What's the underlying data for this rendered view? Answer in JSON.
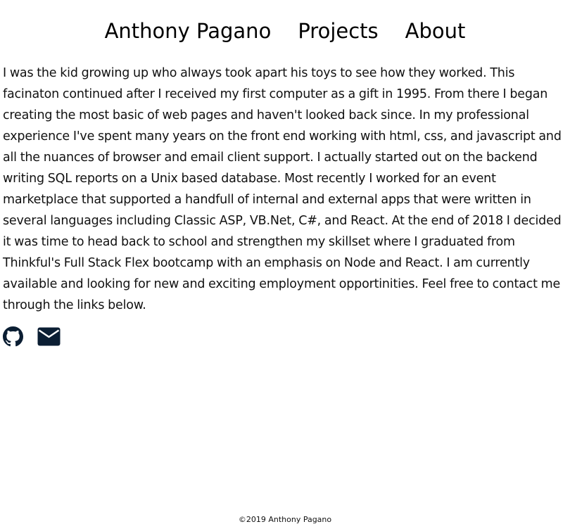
{
  "nav": {
    "items": [
      {
        "label": "Anthony Pagano"
      },
      {
        "label": "Projects"
      },
      {
        "label": "About"
      }
    ]
  },
  "about": {
    "text": "I was the kid growing up who always took apart his toys to see how they worked. This facinaton continued after I received my first computer as a gift in 1995. From there I began creating the most basic of web pages and haven't looked back since. In my professional experience I've spent many years on the front end working with html, css, and javascript and all the nuances of browser and email client support. I actually started out on the backend writing SQL reports on a Unix based database. Most recently I worked for an event marketplace that supported a handfull of internal and external apps that were written in several languages including Classic ASP, VB.Net, C#, and React. At the end of 2018 I decided it was time to head back to school and strengthen my skillset where I graduated from Thinkful's Full Stack Flex bootcamp with an emphasis on Node and React. I am currently available and looking for new and exciting employment opportinities. Feel free to contact me through the links below."
  },
  "links": {
    "github_icon": "github-icon",
    "email_icon": "envelope-icon",
    "icon_color": "#0b1e33"
  },
  "footer": {
    "text": "©2019 Anthony Pagano"
  }
}
